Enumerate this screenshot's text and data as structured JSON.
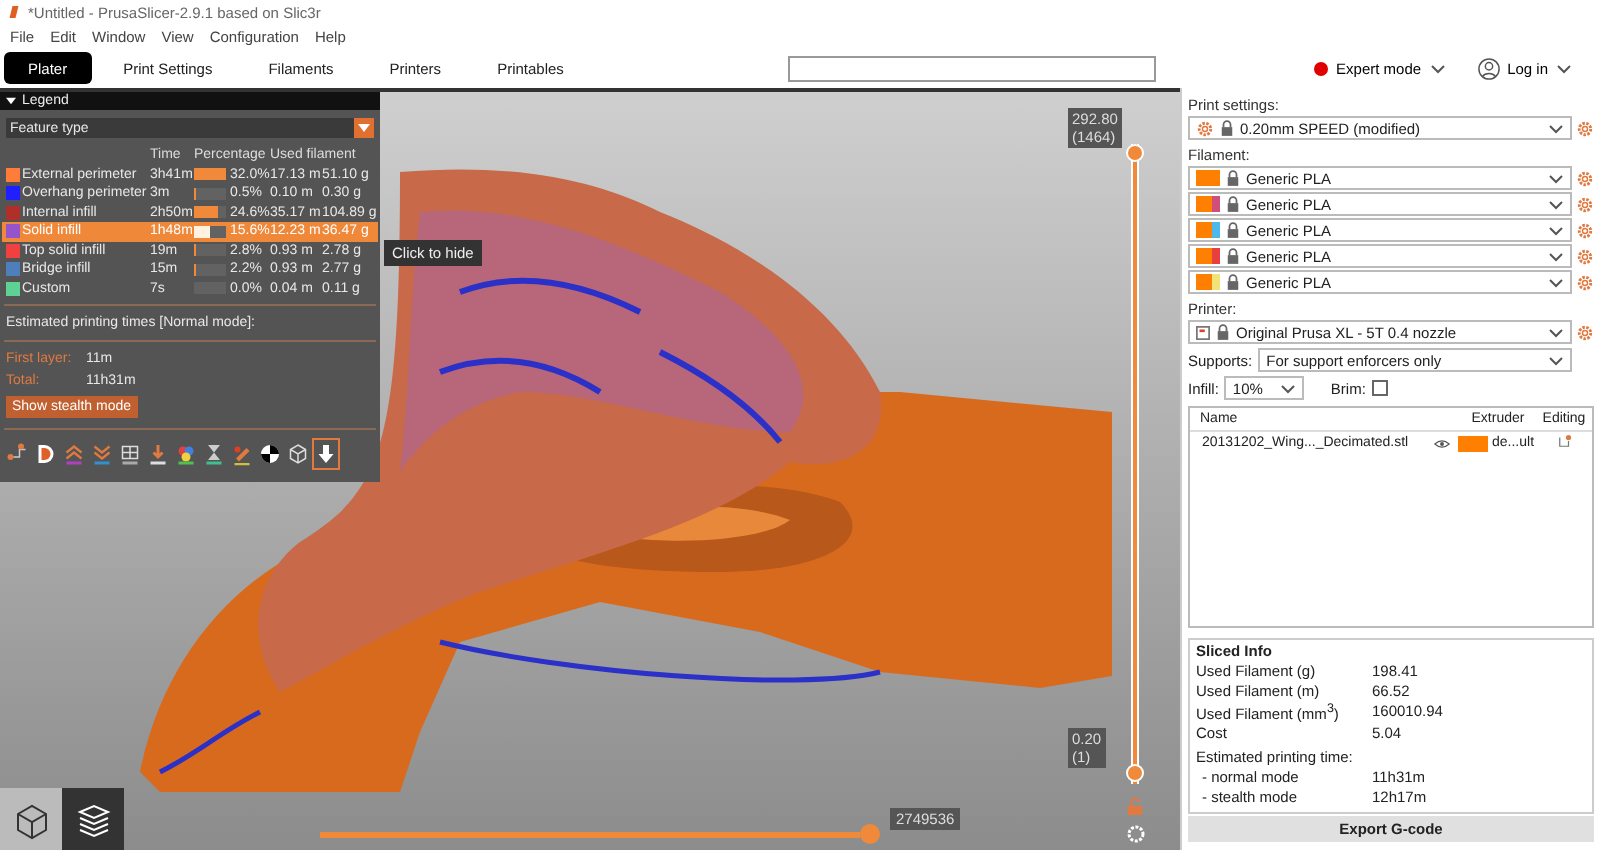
{
  "window": {
    "title": "*Untitled - PrusaSlicer-2.9.1 based on Slic3r"
  },
  "menu": [
    "File",
    "Edit",
    "Window",
    "View",
    "Configuration",
    "Help"
  ],
  "tabs": [
    {
      "label": "Plater",
      "selected": true
    },
    {
      "label": "Print Settings",
      "selected": false
    },
    {
      "label": "Filaments",
      "selected": false
    },
    {
      "label": "Printers",
      "selected": false
    },
    {
      "label": "Printables",
      "selected": false
    }
  ],
  "header": {
    "mode": {
      "label": "Expert mode",
      "color": "#e00000"
    },
    "login": "Log in"
  },
  "legend": {
    "title": "Legend",
    "view_type": "Feature type",
    "columns": [
      "Time",
      "Percentage",
      "Used filament"
    ],
    "items": [
      {
        "label": "External perimeter",
        "color": "#ff7d38",
        "time": "3h41m",
        "level": 1,
        "percentage": "32.0%",
        "length": "17.13 m",
        "weight": "51.10 g",
        "selected": false
      },
      {
        "label": "Overhang perimeter",
        "color": "#1f1fff",
        "time": "3m",
        "level": 0.016,
        "percentage": "0.5%",
        "length": "0.10 m",
        "weight": "0.30 g",
        "selected": false
      },
      {
        "label": "Internal infill",
        "color": "#b03029",
        "time": "2h50m",
        "level": 0.77,
        "percentage": "24.6%",
        "length": "35.17 m",
        "weight": "104.89 g",
        "selected": false
      },
      {
        "label": "Solid infill",
        "color": "#9654cc",
        "time": "1h48m",
        "level": 0.49,
        "percentage": "15.6%",
        "length": "12.23 m",
        "weight": "36.47 g",
        "selected": true
      },
      {
        "label": "Top solid infill",
        "color": "#f04040",
        "time": "19m",
        "level": 0.09,
        "percentage": "2.8%",
        "length": "0.93 m",
        "weight": "2.78 g",
        "selected": false
      },
      {
        "label": "Bridge infill",
        "color": "#4d80ba",
        "time": "15m",
        "level": 0.07,
        "percentage": "2.2%",
        "length": "0.93 m",
        "weight": "2.77 g",
        "selected": false
      },
      {
        "label": "Custom",
        "color": "#5ed194",
        "time": "7s",
        "level": 0.0,
        "percentage": "0.0%",
        "length": "0.04 m",
        "weight": "0.11 g",
        "selected": false
      }
    ],
    "tooltip": "Click to hide",
    "estimated_title": "Estimated printing times [Normal mode]:",
    "first_layer_label": "First layer:",
    "first_layer": "11m",
    "total_label": "Total:",
    "total": "11h31m",
    "stealth_button": "Show stealth mode",
    "toolbar": [
      {
        "kind": "travel",
        "selected": false
      },
      {
        "kind": "wipe",
        "selected": false
      },
      {
        "kind": "retractions",
        "selected": false
      },
      {
        "kind": "deretractions",
        "selected": false
      },
      {
        "kind": "seams",
        "selected": false
      },
      {
        "kind": "tool_changes",
        "selected": false
      },
      {
        "kind": "color_changes",
        "selected": false
      },
      {
        "kind": "pause",
        "selected": false
      },
      {
        "kind": "custom_gcode",
        "selected": false
      },
      {
        "kind": "center_of_gravity",
        "selected": false
      },
      {
        "kind": "shells",
        "selected": false
      },
      {
        "kind": "tool_marker",
        "selected": true
      }
    ]
  },
  "vertical_slider": {
    "thumbs": [
      {
        "value": "292.80",
        "layer": "(1464)",
        "level": 1
      },
      {
        "value": "0.20",
        "layer": "(1)",
        "level": 0
      }
    ]
  },
  "horizontal_slider": {
    "value": "2749536",
    "level": 1
  },
  "view_buttons": [
    {
      "kind": "editor",
      "selected": false
    },
    {
      "kind": "preview",
      "selected": true
    }
  ],
  "sidebar": {
    "print_settings_label": "Print settings:",
    "print_settings": "0.20mm SPEED (modified)",
    "filament_label": "Filament:",
    "filaments": [
      {
        "label": "Generic PLA",
        "swatches": [
          {
            "color": "#ff8000"
          }
        ]
      },
      {
        "label": "Generic PLA",
        "swatches": [
          {
            "color": "#ff8000"
          },
          {
            "color": "#d04f7a"
          }
        ]
      },
      {
        "label": "Generic PLA",
        "swatches": [
          {
            "color": "#ff8000"
          },
          {
            "color": "#4db8ec"
          }
        ]
      },
      {
        "label": "Generic PLA",
        "swatches": [
          {
            "color": "#ff8000"
          },
          {
            "color": "#e84040"
          }
        ]
      },
      {
        "label": "Generic PLA",
        "swatches": [
          {
            "color": "#ff8000"
          },
          {
            "color": "#f2e27a"
          }
        ]
      }
    ],
    "printer_label": "Printer:",
    "printer": "Original Prusa XL - 5T 0.4 nozzle",
    "supports_label": "Supports:",
    "supports": "For support enforcers only",
    "infill_label": "Infill:",
    "infill": "10%",
    "brim_label": "Brim:",
    "brim": false,
    "object_list": {
      "columns": [
        "Name",
        "Extruder",
        "Editing"
      ],
      "rows": [
        {
          "name": "20131202_Wing..._Decimated.stl",
          "extruder": "de...ult",
          "color": "#ff8000"
        }
      ]
    },
    "sliced_info": {
      "title": "Sliced Info",
      "rows": [
        {
          "label": "Used Filament (g)",
          "value": "198.41"
        },
        {
          "label": "Used Filament (m)",
          "value": "66.52"
        },
        {
          "label": "Used Filament (mm$^{3}$)",
          "value": "160010.94"
        },
        {
          "label": "Cost",
          "value": "5.04"
        }
      ],
      "time_title": "Estimated printing time:",
      "times": [
        {
          "label": "- normal mode",
          "value": "11h31m"
        },
        {
          "label": "- stealth mode",
          "value": "12h17m"
        }
      ]
    },
    "export_button": "Export G-code"
  }
}
